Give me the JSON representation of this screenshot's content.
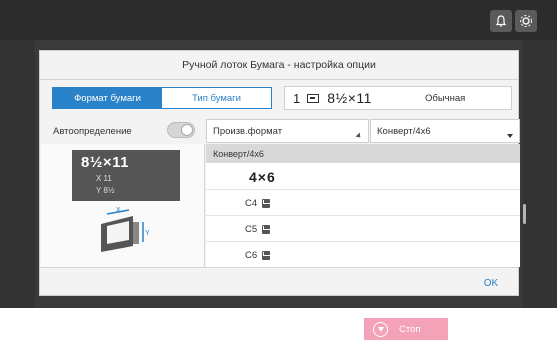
{
  "dialog": {
    "title": "Ручной лоток Бумага - настройка опции",
    "tabs": [
      {
        "label": "Формат бумаги",
        "active": true
      },
      {
        "label": "Тип бумаги",
        "active": false
      }
    ],
    "status": {
      "tray_number": "1",
      "paper_size": "8½×11",
      "paper_type": "Обычная"
    },
    "auto_detect": {
      "label": "Автоопределение",
      "on": false
    },
    "dropdowns": {
      "format_category": "Произв.формат",
      "envelope_size": "Конверт/4x6"
    },
    "preview": {
      "paper_size": "8½×11",
      "x_value": "X 11",
      "y_value": "Y 8½"
    },
    "list": {
      "header": "Конверт/4x6",
      "items": [
        {
          "label": "4×6",
          "icon": null
        },
        {
          "label": "C4",
          "icon": "envelope-icon"
        },
        {
          "label": "C5",
          "icon": "envelope-icon"
        },
        {
          "label": "C6",
          "icon": "envelope-icon"
        }
      ]
    },
    "ok_label": "OK"
  },
  "stop_button": {
    "label": "Стоп"
  },
  "colors": {
    "accent": "#2a82c9",
    "stop": "#f3a2b7",
    "device_bg": "#3a3a3a"
  }
}
